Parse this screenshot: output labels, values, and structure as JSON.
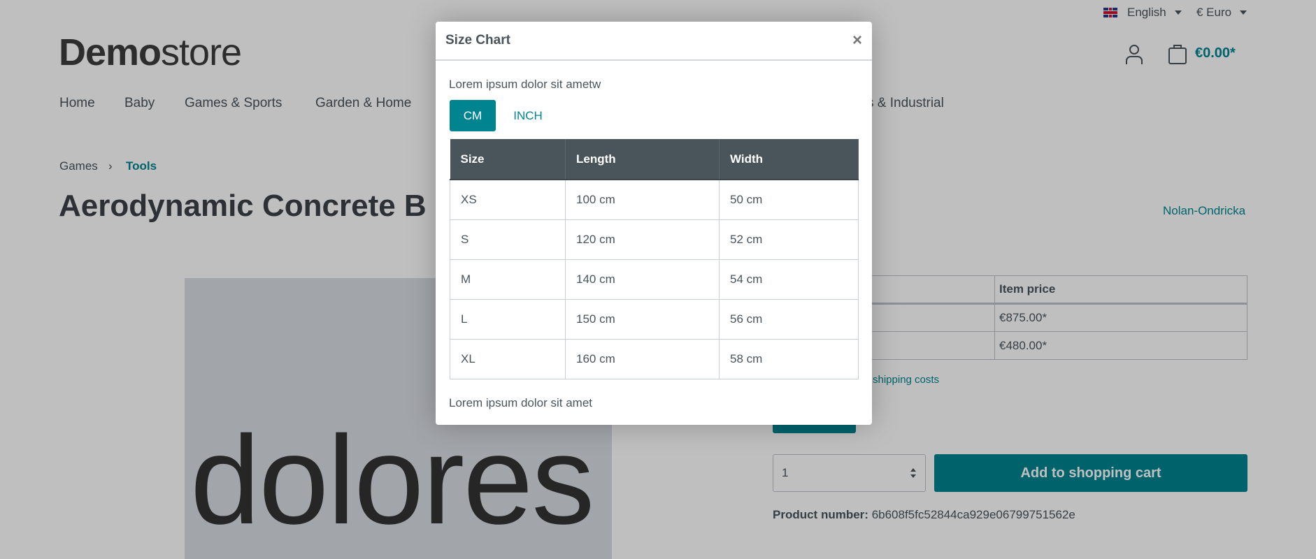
{
  "topbar": {
    "language": "English",
    "currency": "€ Euro"
  },
  "logo": {
    "bold": "Demo",
    "light": "store"
  },
  "header": {
    "cart_total": "€0.00*"
  },
  "nav": [
    "Home",
    "Baby",
    "Games & Sports",
    "Garden & Home",
    "s & Industrial"
  ],
  "breadcrumb": {
    "parent": "Games",
    "separator": "›",
    "current": "Tools"
  },
  "product": {
    "title": "Aerodynamic Concrete B",
    "manufacturer": "Nolan-Ondricka",
    "image_text": "dolores",
    "price_table": {
      "header": "Item price",
      "rows": [
        "€875.00*",
        "€480.00*"
      ]
    },
    "shipping": "shipping costs",
    "quantity": "1",
    "add_to_cart": "Add to shopping cart",
    "product_number_label": "Product number:",
    "product_number": "6b608f5fc52844ca929e06799751562e"
  },
  "modal": {
    "title": "Size Chart",
    "close": "×",
    "intro": "Lorem ipsum dolor sit ametw",
    "units": [
      "CM",
      "INCH"
    ],
    "selected_unit": "CM",
    "columns": [
      "Size",
      "Length",
      "Width"
    ],
    "rows": [
      [
        "XS",
        "100 cm",
        "50 cm"
      ],
      [
        "S",
        "120 cm",
        "52 cm"
      ],
      [
        "M",
        "140 cm",
        "54 cm"
      ],
      [
        "L",
        "150 cm",
        "56 cm"
      ],
      [
        "XL",
        "160 cm",
        "58 cm"
      ]
    ],
    "footer": "Lorem ipsum dolor sit amet"
  },
  "icons": [
    "uk-flag-icon",
    "caret-down-icon",
    "account-icon",
    "cart-icon",
    "chevron-right-icon",
    "select-arrows-icon",
    "close-icon"
  ],
  "colors": {
    "primary": "#008490",
    "table_header": "#4a545b",
    "text": "#4a545b"
  }
}
